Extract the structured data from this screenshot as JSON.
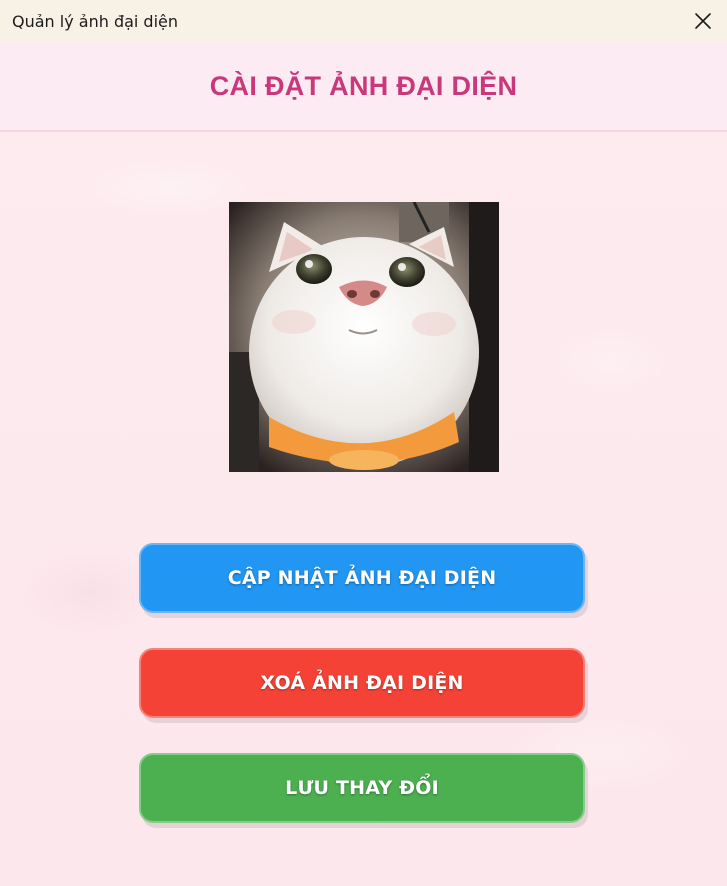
{
  "window": {
    "title": "Quản lý ảnh đại diện",
    "close_icon": "close-icon"
  },
  "header": {
    "title": "CÀI ĐẶT ẢNH ĐẠI DIỆN"
  },
  "avatar": {
    "description_icon": "cat-photo"
  },
  "actions": {
    "update_label": "CẬP NHẬT ẢNH ĐẠI DIỆN",
    "delete_label": "XOÁ ẢNH ĐẠI DIỆN",
    "save_label": "LƯU THAY ĐỔI"
  },
  "colors": {
    "title_color": "#c8387a",
    "update": "#2196f3",
    "delete": "#f44336",
    "save": "#4caf50",
    "background": "#fdeef2",
    "titlebar": "#f8f1e6"
  }
}
